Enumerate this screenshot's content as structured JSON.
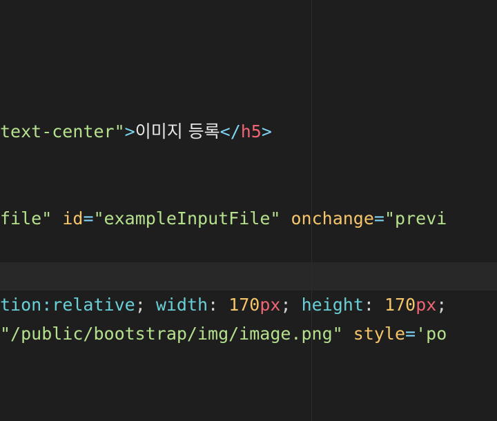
{
  "editor": {
    "lines": [
      {
        "s1": "text-center\"",
        "p1": ">",
        "txt": "이미지 등록",
        "p2": "</",
        "tag": "h5",
        "p3": ">"
      },
      {
        "s1": "file\"",
        "a1": "id",
        "e1": "=",
        "s2": "\"exampleInputFile\"",
        "a2": "onchange",
        "e2": "=",
        "s3": "\"previ"
      },
      {
        "c1": "tion:",
        "v1": "relative",
        "sc1": ";",
        "c2": "width",
        "co2": ":",
        "n2": "170",
        "u2": "px",
        "sc2": ";",
        "c3": "height",
        "co3": ":",
        "n3": "170",
        "u3": "px",
        "sc3": ";"
      },
      {
        "s1": "\"/public/bootstrap/img/image.png\"",
        "a1": "style",
        "e1": "=",
        "s2": "'po"
      }
    ]
  }
}
